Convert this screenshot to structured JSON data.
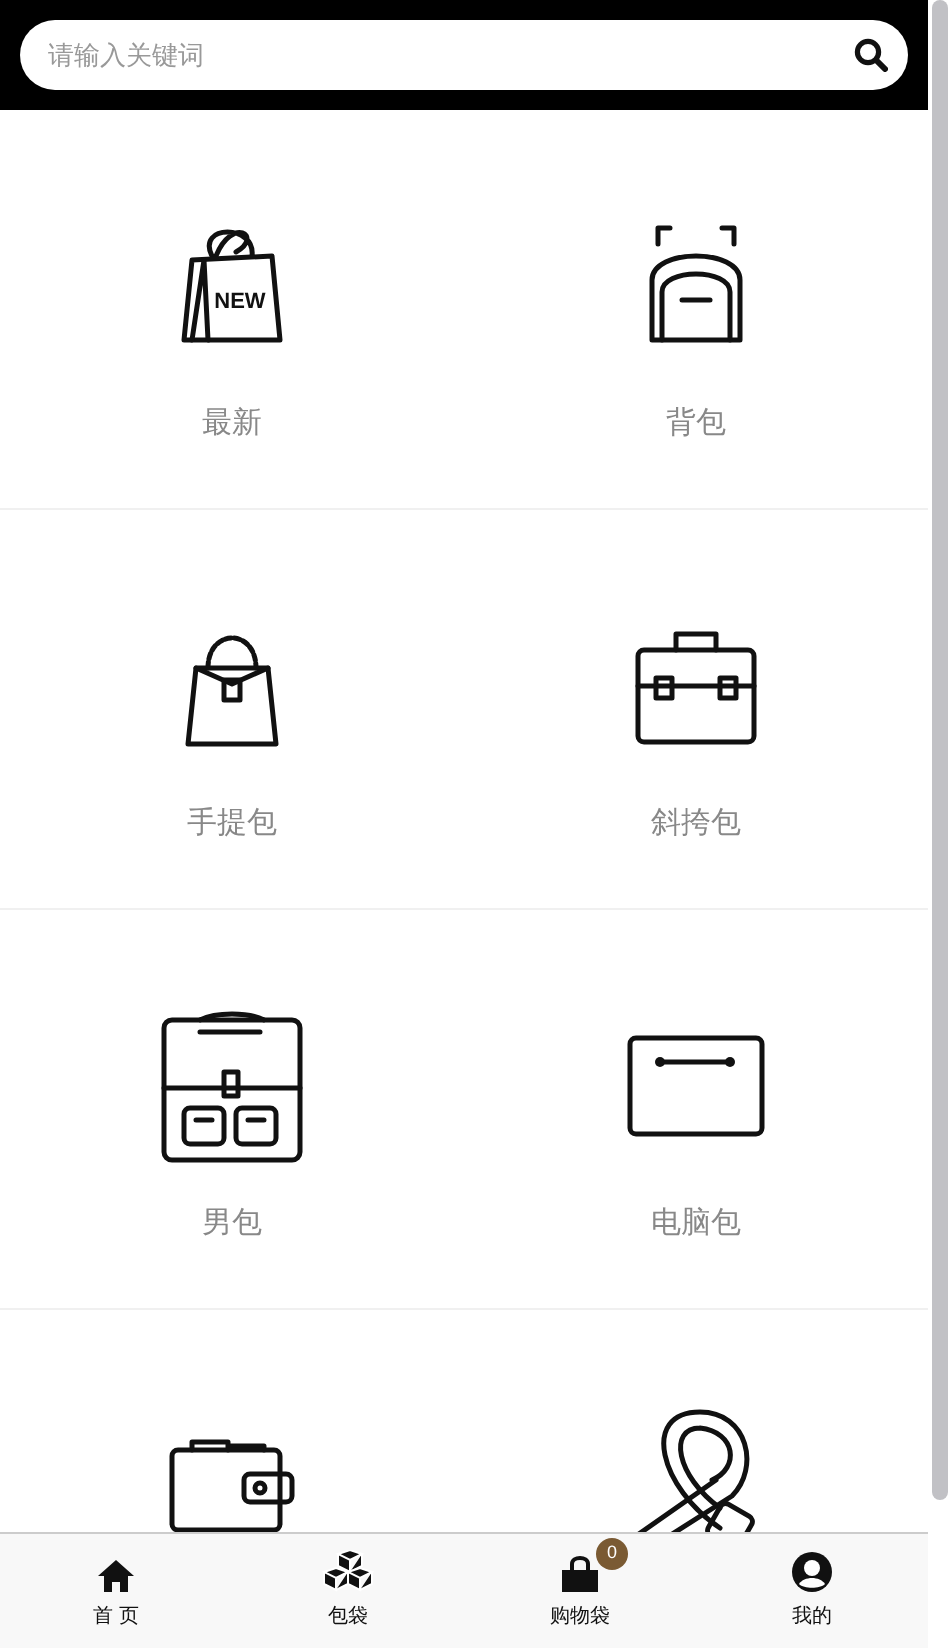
{
  "search": {
    "placeholder": "请输入关键词"
  },
  "categories": [
    {
      "kind": "labeled",
      "badge_text": "NEW",
      "label": "最新"
    },
    {
      "kind": "labeled",
      "label": "背包"
    },
    {
      "kind": "labeled",
      "label": "手提包"
    },
    {
      "kind": "labeled",
      "label": "斜挎包"
    },
    {
      "kind": "labeled",
      "label": "男包"
    },
    {
      "kind": "labeled",
      "label": "电脑包"
    },
    {
      "kind": "icon-only"
    },
    {
      "kind": "icon-only"
    }
  ],
  "nav": [
    {
      "label": "首 页"
    },
    {
      "label": "包袋"
    },
    {
      "label": "购物袋",
      "badge": "0"
    },
    {
      "label": "我的"
    }
  ]
}
